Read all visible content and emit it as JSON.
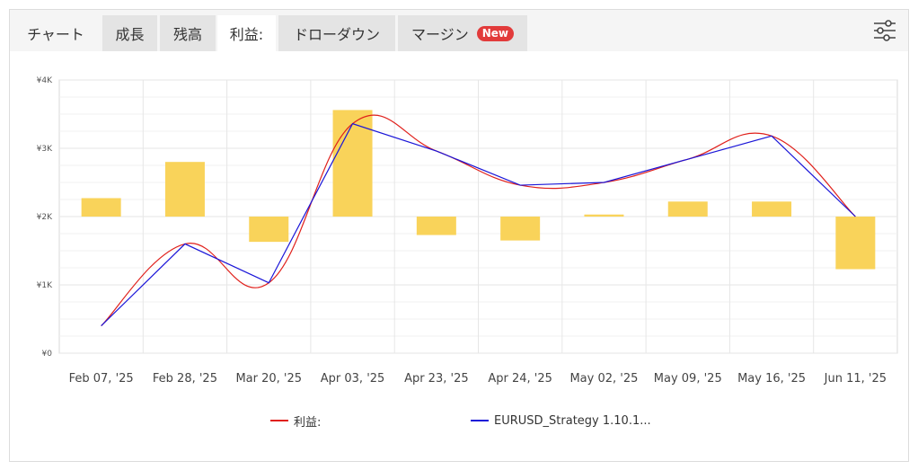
{
  "tabs": [
    {
      "label": "チャート"
    },
    {
      "label": "成長"
    },
    {
      "label": "残高"
    },
    {
      "label": "利益:"
    },
    {
      "label": "ドローダウン"
    },
    {
      "label": "マージン"
    }
  ],
  "new_badge": "New",
  "settings_icon": "sliders-icon",
  "colors": {
    "bar": "#f9d35a",
    "profit_line": "#e0201b",
    "strategy_line": "#1b16d8",
    "grid": "#e6e6e6",
    "badge": "#e23b3b"
  },
  "chart_data": {
    "type": "bar",
    "categories": [
      "Feb 07, '25",
      "Feb 28, '25",
      "Mar 20, '25",
      "Apr 03, '25",
      "Apr 23, '25",
      "Apr 24, '25",
      "May 02, '25",
      "May 09, '25",
      "May 16, '25",
      "Jun 11, '25"
    ],
    "y_ticks": [
      "¥0",
      "¥1K",
      "¥2K",
      "¥3K",
      "¥4K"
    ],
    "ylim": [
      0,
      4000
    ],
    "bars": {
      "base": 2000,
      "values": [
        2270,
        2800,
        1630,
        3560,
        1730,
        1650,
        2030,
        2220,
        2220,
        1230
      ]
    },
    "series": [
      {
        "name": "利益:",
        "style": "smooth",
        "values": [
          400,
          1600,
          1030,
          3360,
          2960,
          2460,
          2500,
          2840,
          3180,
          2000
        ]
      },
      {
        "name": "EURUSD_Strategy 1.10.1...",
        "style": "straight",
        "values": [
          400,
          1600,
          1030,
          3360,
          2960,
          2460,
          2500,
          2840,
          3180,
          2000
        ]
      }
    ],
    "grid": true,
    "legend_position": "bottom"
  }
}
